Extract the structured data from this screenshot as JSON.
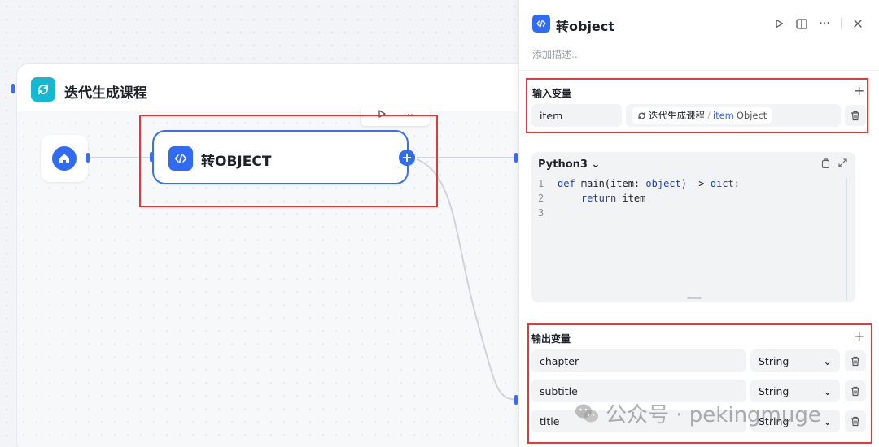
{
  "canvas": {
    "iteration_title": "迭代生成课程",
    "code_node_title": "转OBJECT"
  },
  "panel": {
    "title": "转object",
    "description_placeholder": "添加描述...",
    "input_section": {
      "label": "输入变量",
      "add": "+",
      "variables": [
        {
          "name": "item",
          "ref_source": "迭代生成课程",
          "ref_sep": "/",
          "ref_var": "item",
          "ref_type": "Object"
        }
      ]
    },
    "code": {
      "language": "Python3",
      "lines": [
        {
          "num": "1",
          "text": "def main(item: object) -> dict:"
        },
        {
          "num": "2",
          "text": "    return item"
        },
        {
          "num": "3",
          "text": ""
        }
      ]
    },
    "output_section": {
      "label": "输出变量",
      "add": "+",
      "variables": [
        {
          "name": "chapter",
          "type": "String"
        },
        {
          "name": "subtitle",
          "type": "String"
        },
        {
          "name": "title",
          "type": "String"
        }
      ]
    }
  },
  "watermark": {
    "text": "公众号 · pekingmuge"
  },
  "colors": {
    "accent": "#2f6bf5",
    "iteration": "#14b8d0",
    "highlight": "#e53935"
  }
}
